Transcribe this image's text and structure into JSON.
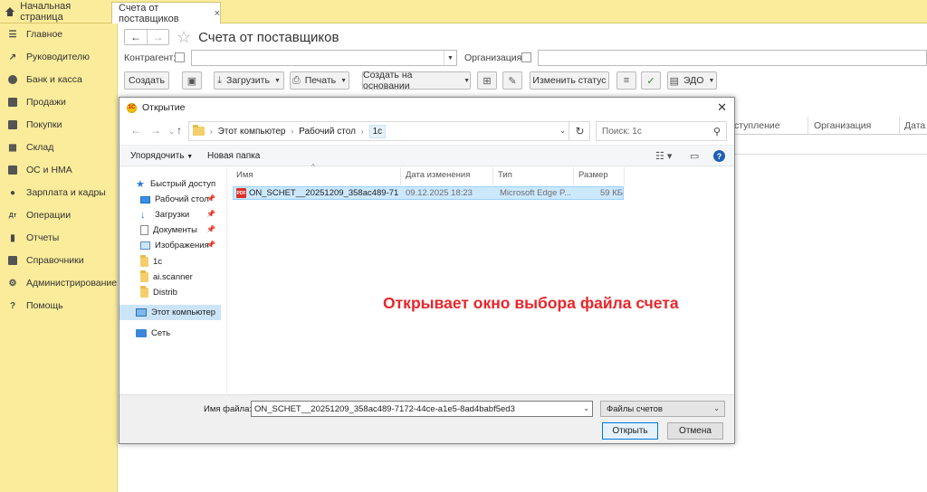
{
  "tabs": {
    "home": "Начальная страница",
    "active": "Счета от поставщиков",
    "close": "×"
  },
  "sidebar": {
    "items": [
      {
        "label": "Главное",
        "icon": "menu-icon"
      },
      {
        "label": "Руководителю",
        "icon": "trend-icon"
      },
      {
        "label": "Банк и касса",
        "icon": "coin-icon"
      },
      {
        "label": "Продажи",
        "icon": "cart-icon"
      },
      {
        "label": "Покупки",
        "icon": "basket-icon"
      },
      {
        "label": "Склад",
        "icon": "warehouse-icon"
      },
      {
        "label": "ОС и НМА",
        "icon": "truck-icon"
      },
      {
        "label": "Зарплата и кадры",
        "icon": "person-icon"
      },
      {
        "label": "Операции",
        "icon": "operations-icon"
      },
      {
        "label": "Отчеты",
        "icon": "report-icon"
      },
      {
        "label": "Справочники",
        "icon": "book-icon"
      },
      {
        "label": "Администрирование",
        "icon": "gear-icon"
      },
      {
        "label": "Помощь",
        "icon": "help-icon"
      }
    ]
  },
  "form": {
    "title": "Счета от поставщиков",
    "back": "←",
    "forward": "→",
    "star": "☆",
    "filters": {
      "counterparty_label": "Контрагент:",
      "organization_label": "Организация:"
    },
    "toolbar": {
      "create": "Создать",
      "load": "Загрузить",
      "print": "Печать",
      "create_based_on": "Создать на основании",
      "change_status": "Изменить статус",
      "edo": "ЭДО"
    },
    "grid_columns": [
      "ступление",
      "Организация",
      "Дата"
    ]
  },
  "dialog": {
    "title": "Открытие",
    "close": "✕",
    "breadcrumb": [
      "Этот компьютер",
      "Рабочий стол",
      "1c"
    ],
    "search_placeholder": "Поиск: 1c",
    "commands": {
      "organize": "Упорядочить",
      "new_folder": "Новая папка"
    },
    "nav_pane": {
      "quick_access": "Быстрый доступ",
      "items": [
        "Рабочий стол",
        "Загрузки",
        "Документы",
        "Изображения",
        "1c",
        "ai.scanner",
        "Distrib"
      ],
      "this_pc": "Этот компьютер",
      "network": "Сеть"
    },
    "columns": {
      "name": "Имя",
      "date": "Дата изменения",
      "type": "Тип",
      "size": "Размер"
    },
    "file": {
      "name": "ON_SCHET__20251209_358ac489-7172-4...",
      "date": "09.12.2025 18:23",
      "type": "Microsoft Edge P...",
      "size": "59 КБ",
      "icon_text": "PDF"
    },
    "annotation": "Открывает окно выбора файла счета",
    "filename_label": "Имя файла:",
    "filename_value": "ON_SCHET__20251209_358ac489-7172-44ce-a1e5-8ad4babf5ed3",
    "filetype": "Файлы счетов",
    "open_button": "Открыть",
    "cancel_button": "Отмена"
  }
}
